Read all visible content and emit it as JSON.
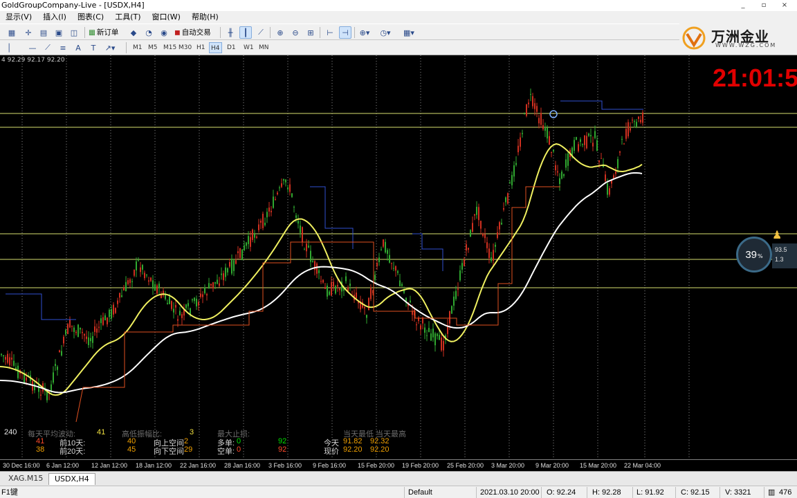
{
  "window": {
    "title": "GoldGroupCompany-Live - [USDX,H4]",
    "controls": [
      "_",
      "▫",
      "×"
    ]
  },
  "menu": [
    "显示(V)",
    "插入(I)",
    "图表(C)",
    "工具(T)",
    "窗口(W)",
    "帮助(H)"
  ],
  "toolbar": {
    "new_order": "新订单",
    "auto_trading": "自动交易",
    "timeframes": [
      "M1",
      "M5",
      "M15",
      "M30",
      "H1",
      "H4",
      "D1",
      "W1",
      "MN"
    ],
    "active_timeframe": "H4"
  },
  "logo": {
    "name": "万洲金业",
    "url": "WWW.WZG.COM"
  },
  "chart": {
    "symbol": "USDX",
    "timeframe": "H4",
    "ohlc_readout": "4 92.29 92.17 92.20",
    "clock": "21:01:5",
    "colors": {
      "bull": "#d03020",
      "bear": "#30a830",
      "ma_fast": "#f0f060",
      "ma_slow": "#ffffff",
      "stop_up": "#3050d0",
      "stop_down": "#e05020",
      "level_line": "#d8e070",
      "grid": "#c8c8c8"
    },
    "time_labels": [
      "30 Dec 16:00",
      "6 Jan 12:00",
      "12 Jan 12:00",
      "18 Jan 12:00",
      "22 Jan 16:00",
      "28 Jan 16:00",
      "3 Feb 16:00",
      "9 Feb 16:00",
      "15 Feb 20:00",
      "19 Feb 20:00",
      "25 Feb 20:00",
      "3 Mar 20:00",
      "9 Mar 20:00",
      "15 Mar 20:00",
      "22 Mar 04:00"
    ]
  },
  "widget": {
    "gauge_value": "39",
    "gauge_unit": "%",
    "up_value": "93.5",
    "down_value": "1.3"
  },
  "stats": {
    "period": "240",
    "avg_range_label": "每天平均波动:",
    "avg_range_value": "41",
    "prev10_value_left": "41",
    "prev10_label": "前10天:",
    "prev10_value": "40",
    "prev20_value_left": "38",
    "prev20_label": "前20天:",
    "prev20_value": "45",
    "ratio_label": "高低振幅比:",
    "ratio_value": "3",
    "up_gap_label": "向上空间",
    "up_gap_value": "2",
    "down_gap_label": "向下空间",
    "down_gap_value": "29",
    "max_stop_label": "最大止损:",
    "long_label": "多单:",
    "long_value": "0",
    "short_label": "空单:",
    "short_value": "0",
    "long_price": "92",
    "short_price": "92",
    "daily_header": "当天最低 当天最高",
    "today_label": "今天",
    "today_low": "91.82",
    "today_high": "92.32",
    "current_label": "现价",
    "current_low": "92.20",
    "current_high": "92.20"
  },
  "tabs": [
    "XAG.M15",
    "USDX,H4"
  ],
  "active_tab": "USDX,H4",
  "status": {
    "help": "F1键",
    "profile": "Default",
    "datetime": "2021.03.10 20:00",
    "open": "O: 92.24",
    "high": "H: 92.28",
    "low": "L: 91.92",
    "close": "C: 92.15",
    "volume": "V: 3321",
    "traffic": "476"
  }
}
